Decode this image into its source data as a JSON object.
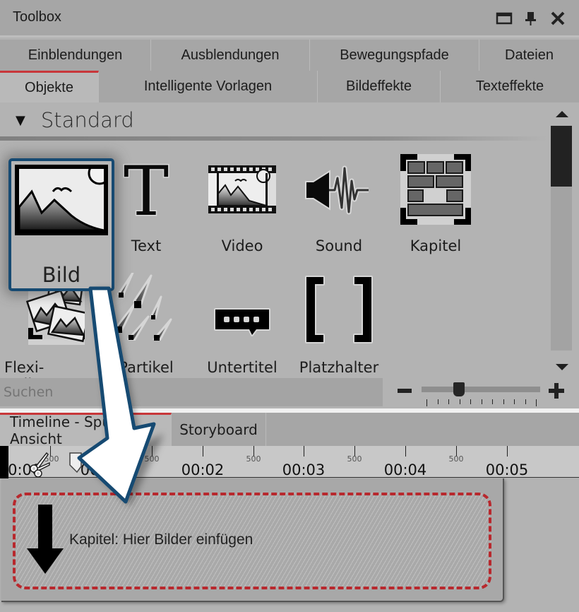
{
  "window": {
    "title": "Toolbox",
    "controls": [
      {
        "name": "maximize-icon"
      },
      {
        "name": "pin-icon"
      },
      {
        "name": "close-icon"
      }
    ]
  },
  "tabs_row1": [
    {
      "label": "Einblendungen"
    },
    {
      "label": "Ausblendungen"
    },
    {
      "label": "Bewegungspfade"
    },
    {
      "label": "Dateien"
    }
  ],
  "tabs_row2": [
    {
      "label": "Objekte",
      "active": true
    },
    {
      "label": "Intelligente Vorlagen"
    },
    {
      "label": "Bildeffekte"
    },
    {
      "label": "Texteffekte"
    }
  ],
  "section": {
    "label": "Standard",
    "expanded": true
  },
  "objects": [
    {
      "label": "Bild",
      "icon": "image-icon",
      "selected": true
    },
    {
      "label": "Text",
      "icon": "text-icon"
    },
    {
      "label": "Video",
      "icon": "video-icon"
    },
    {
      "label": "Sound",
      "icon": "sound-icon"
    },
    {
      "label": "Kapitel",
      "icon": "chapter-icon"
    },
    {
      "label": "Flexi-Colla...",
      "icon": "flexi-collage-icon"
    },
    {
      "label": "Partikel",
      "icon": "particle-icon"
    },
    {
      "label": "Untertitel",
      "icon": "subtitle-icon"
    },
    {
      "label": "Platzhalter",
      "icon": "placeholder-icon"
    }
  ],
  "search": {
    "placeholder": "Suchen"
  },
  "icon_zoom": {
    "value_fraction": 0.3,
    "ticks": 11
  },
  "timeline_tabs": [
    {
      "label": "Timeline - Spur-Ansicht",
      "active": true
    },
    {
      "label": "Storyboard"
    }
  ],
  "ruler": {
    "times": [
      "00:00",
      "00:01",
      "00:02",
      "00:03",
      "00:04",
      "00:05"
    ],
    "sub_label": "500"
  },
  "chapter": {
    "label": "Kapitel: Hier Bilder einfügen"
  },
  "colors": {
    "accent_red": "#c8373a",
    "selection_blue": "#164a72",
    "drop_border": "#b8282d"
  }
}
